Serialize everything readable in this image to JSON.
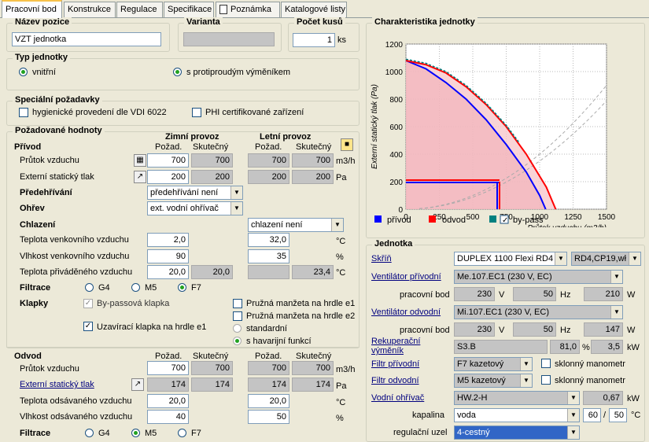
{
  "tabs": [
    "Pracovní bod",
    "Konstrukce",
    "Regulace",
    "Specifikace",
    "Poznámka",
    "Katalogové listy"
  ],
  "header": {
    "nazev_label": "Název pozice",
    "nazev_value": "VZT jednotka",
    "varianta_label": "Varianta",
    "varianta_value": "",
    "pocet_label": "Počet kusů",
    "pocet_value": "1",
    "pocet_unit": "ks"
  },
  "typ": {
    "label": "Typ jednotky",
    "opt1": "vnitřní",
    "opt2": "s protiproudým výměníkem"
  },
  "special": {
    "label": "Speciální požadavky",
    "opt1": "hygienické provedení dle VDI 6022",
    "opt2": "PHI certifikované zařízení"
  },
  "pozad": {
    "label": "Požadované hodnoty",
    "zimni": "Zimní provoz",
    "letni": "Letní provoz",
    "pozad_col": "Požad.",
    "skut_col": "Skutečný"
  },
  "privod": {
    "label": "Přívod",
    "prutok_label": "Průtok vzduchu",
    "prutok": [
      "700",
      "700",
      "700",
      "700"
    ],
    "prutok_unit": "m3/h",
    "tlak_label": "Externí statický tlak",
    "tlak": [
      "200",
      "200",
      "200",
      "200"
    ],
    "tlak_unit": "Pa",
    "predehrivani_label": "Předehřívání",
    "predehrivani": "předehřívání není",
    "ohrev_label": "Ohřev",
    "ohrev": "ext. vodní ohřívač",
    "chlazeni_label": "Chlazení",
    "chlazeni": "chlazení není",
    "tv_label": "Teplota venkovního vzduchu",
    "tv": [
      "2,0",
      "32,0"
    ],
    "tv_unit": "°C",
    "vv_label": "Vlhkost venkovního vzduchu",
    "vv": [
      "90",
      "35"
    ],
    "vv_unit": "%",
    "tp_label": "Teplota přiváděného vzduchu",
    "tp": [
      "20,0",
      "20,0",
      "",
      "23,4"
    ],
    "tp_unit": "°C",
    "filtrace_label": "Filtrace",
    "f1": "G4",
    "f2": "M5",
    "f3": "F7",
    "klapky_label": "Klapky",
    "k1": "By-passová klapka",
    "k2": "Uzavírací klapka na hrdle e1",
    "k3": "Pružná manžeta na hrdle e1",
    "k4": "Pružná manžeta na hrdle e2",
    "k5": "standardní",
    "k6": "s havarijní funkcí"
  },
  "odvod": {
    "label": "Odvod",
    "pozad_col": "Požad.",
    "skut_col": "Skutečný",
    "prutok_label": "Průtok vzduchu",
    "prutok": [
      "700",
      "700",
      "700",
      "700"
    ],
    "prutok_unit": "m3/h",
    "tlak_label": "Externí statický tlak",
    "tlak": [
      "174",
      "174",
      "174",
      "174"
    ],
    "tlak_unit": "Pa",
    "to_label": "Teplota odsávaného vzduchu",
    "to": [
      "20,0",
      "20,0"
    ],
    "to_unit": "°C",
    "vo_label": "Vlhkost odsávaného vzduchu",
    "vo": [
      "40",
      "50"
    ],
    "vo_unit": "%",
    "filtrace_label": "Filtrace",
    "f1": "G4",
    "f2": "M5",
    "f3": "F7"
  },
  "chart_title": "Charakteristika jednotky",
  "chart_data": {
    "type": "line",
    "xlabel": "Průtok vzduchu (m3/h)",
    "ylabel": "Externí statický tlak (Pa)",
    "xlim": [
      0,
      1500
    ],
    "ylim": [
      0,
      1200
    ],
    "xticks": [
      "0",
      "250",
      "500",
      "750",
      "1000",
      "1250",
      "1500"
    ],
    "yticks": [
      "0",
      "200",
      "400",
      "600",
      "800",
      "1000",
      "1200"
    ],
    "series": [
      {
        "name": "přívod",
        "color": "#0000ff",
        "x": [
          0,
          150,
          300,
          450,
          600,
          750,
          900,
          1000,
          1045
        ],
        "y": [
          1080,
          1020,
          920,
          800,
          650,
          470,
          270,
          100,
          0
        ]
      },
      {
        "name": "odvod",
        "color": "#ff0000",
        "x": [
          0,
          150,
          300,
          450,
          600,
          750,
          900,
          1050,
          1120
        ],
        "y": [
          1080,
          1050,
          990,
          890,
          760,
          600,
          400,
          160,
          0
        ]
      },
      {
        "name": "by-pass",
        "color": "#008080",
        "x": [
          0,
          150,
          300,
          450,
          600,
          750,
          850
        ],
        "y": [
          1090,
          1060,
          1000,
          900,
          770,
          610,
          480
        ]
      }
    ],
    "work_point": {
      "x": 700,
      "y": 200
    },
    "grid": true,
    "legend": "bottom"
  },
  "legend": {
    "privod": "přívod",
    "odvod": "odvod",
    "bypass": "by-pass"
  },
  "jednotka": {
    "label": "Jednotka",
    "skrin_label": "Skříň",
    "skrin": "DUPLEX 1100 Flexi RD4",
    "skrin2": "RD4,CP19,wł",
    "vent_priv_label": "Ventilátor přívodní",
    "vent_priv": "Me.107.EC1 (230 V, EC)",
    "pb_label": "pracovní bod",
    "pb1": [
      "230",
      "V",
      "50",
      "Hz",
      "210",
      "W"
    ],
    "vent_odv_label": "Ventilátor odvodní",
    "vent_odv": "Mi.107.EC1 (230 V, EC)",
    "pb2": [
      "230",
      "V",
      "50",
      "Hz",
      "147",
      "W"
    ],
    "rek_label": "Rekuperační výměník",
    "rek": "S3.B",
    "rek_val": "81,0",
    "rek_unit": "%",
    "rek_kw": "3,5",
    "kw": "kW",
    "filtr_priv_label": "Filtr přívodní",
    "filtr_priv": "F7 kazetový",
    "manometr": "sklonný manometr",
    "filtr_odv_label": "Filtr odvodní",
    "filtr_odv": "M5 kazetový",
    "ohrivac_label": "Vodní ohřívač",
    "ohrivac": "HW.2-H",
    "ohrivac_kw": "0,67",
    "kapalina_label": "kapalina",
    "kapalina": "voda",
    "t1": "60",
    "slash": "/",
    "t2": "50",
    "t_unit": "°C",
    "reg_label": "regulační uzel",
    "reg": "4-cestný"
  }
}
